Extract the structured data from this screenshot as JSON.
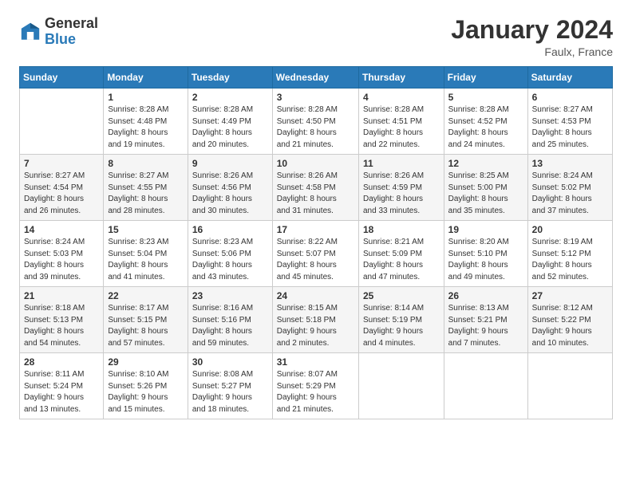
{
  "header": {
    "logo_general": "General",
    "logo_blue": "Blue",
    "month_title": "January 2024",
    "location": "Faulx, France"
  },
  "days_of_week": [
    "Sunday",
    "Monday",
    "Tuesday",
    "Wednesday",
    "Thursday",
    "Friday",
    "Saturday"
  ],
  "weeks": [
    [
      {
        "day": "",
        "info": ""
      },
      {
        "day": "1",
        "info": "Sunrise: 8:28 AM\nSunset: 4:48 PM\nDaylight: 8 hours\nand 19 minutes."
      },
      {
        "day": "2",
        "info": "Sunrise: 8:28 AM\nSunset: 4:49 PM\nDaylight: 8 hours\nand 20 minutes."
      },
      {
        "day": "3",
        "info": "Sunrise: 8:28 AM\nSunset: 4:50 PM\nDaylight: 8 hours\nand 21 minutes."
      },
      {
        "day": "4",
        "info": "Sunrise: 8:28 AM\nSunset: 4:51 PM\nDaylight: 8 hours\nand 22 minutes."
      },
      {
        "day": "5",
        "info": "Sunrise: 8:28 AM\nSunset: 4:52 PM\nDaylight: 8 hours\nand 24 minutes."
      },
      {
        "day": "6",
        "info": "Sunrise: 8:27 AM\nSunset: 4:53 PM\nDaylight: 8 hours\nand 25 minutes."
      }
    ],
    [
      {
        "day": "7",
        "info": "Sunrise: 8:27 AM\nSunset: 4:54 PM\nDaylight: 8 hours\nand 26 minutes."
      },
      {
        "day": "8",
        "info": "Sunrise: 8:27 AM\nSunset: 4:55 PM\nDaylight: 8 hours\nand 28 minutes."
      },
      {
        "day": "9",
        "info": "Sunrise: 8:26 AM\nSunset: 4:56 PM\nDaylight: 8 hours\nand 30 minutes."
      },
      {
        "day": "10",
        "info": "Sunrise: 8:26 AM\nSunset: 4:58 PM\nDaylight: 8 hours\nand 31 minutes."
      },
      {
        "day": "11",
        "info": "Sunrise: 8:26 AM\nSunset: 4:59 PM\nDaylight: 8 hours\nand 33 minutes."
      },
      {
        "day": "12",
        "info": "Sunrise: 8:25 AM\nSunset: 5:00 PM\nDaylight: 8 hours\nand 35 minutes."
      },
      {
        "day": "13",
        "info": "Sunrise: 8:24 AM\nSunset: 5:02 PM\nDaylight: 8 hours\nand 37 minutes."
      }
    ],
    [
      {
        "day": "14",
        "info": "Sunrise: 8:24 AM\nSunset: 5:03 PM\nDaylight: 8 hours\nand 39 minutes."
      },
      {
        "day": "15",
        "info": "Sunrise: 8:23 AM\nSunset: 5:04 PM\nDaylight: 8 hours\nand 41 minutes."
      },
      {
        "day": "16",
        "info": "Sunrise: 8:23 AM\nSunset: 5:06 PM\nDaylight: 8 hours\nand 43 minutes."
      },
      {
        "day": "17",
        "info": "Sunrise: 8:22 AM\nSunset: 5:07 PM\nDaylight: 8 hours\nand 45 minutes."
      },
      {
        "day": "18",
        "info": "Sunrise: 8:21 AM\nSunset: 5:09 PM\nDaylight: 8 hours\nand 47 minutes."
      },
      {
        "day": "19",
        "info": "Sunrise: 8:20 AM\nSunset: 5:10 PM\nDaylight: 8 hours\nand 49 minutes."
      },
      {
        "day": "20",
        "info": "Sunrise: 8:19 AM\nSunset: 5:12 PM\nDaylight: 8 hours\nand 52 minutes."
      }
    ],
    [
      {
        "day": "21",
        "info": "Sunrise: 8:18 AM\nSunset: 5:13 PM\nDaylight: 8 hours\nand 54 minutes."
      },
      {
        "day": "22",
        "info": "Sunrise: 8:17 AM\nSunset: 5:15 PM\nDaylight: 8 hours\nand 57 minutes."
      },
      {
        "day": "23",
        "info": "Sunrise: 8:16 AM\nSunset: 5:16 PM\nDaylight: 8 hours\nand 59 minutes."
      },
      {
        "day": "24",
        "info": "Sunrise: 8:15 AM\nSunset: 5:18 PM\nDaylight: 9 hours\nand 2 minutes."
      },
      {
        "day": "25",
        "info": "Sunrise: 8:14 AM\nSunset: 5:19 PM\nDaylight: 9 hours\nand 4 minutes."
      },
      {
        "day": "26",
        "info": "Sunrise: 8:13 AM\nSunset: 5:21 PM\nDaylight: 9 hours\nand 7 minutes."
      },
      {
        "day": "27",
        "info": "Sunrise: 8:12 AM\nSunset: 5:22 PM\nDaylight: 9 hours\nand 10 minutes."
      }
    ],
    [
      {
        "day": "28",
        "info": "Sunrise: 8:11 AM\nSunset: 5:24 PM\nDaylight: 9 hours\nand 13 minutes."
      },
      {
        "day": "29",
        "info": "Sunrise: 8:10 AM\nSunset: 5:26 PM\nDaylight: 9 hours\nand 15 minutes."
      },
      {
        "day": "30",
        "info": "Sunrise: 8:08 AM\nSunset: 5:27 PM\nDaylight: 9 hours\nand 18 minutes."
      },
      {
        "day": "31",
        "info": "Sunrise: 8:07 AM\nSunset: 5:29 PM\nDaylight: 9 hours\nand 21 minutes."
      },
      {
        "day": "",
        "info": ""
      },
      {
        "day": "",
        "info": ""
      },
      {
        "day": "",
        "info": ""
      }
    ]
  ]
}
